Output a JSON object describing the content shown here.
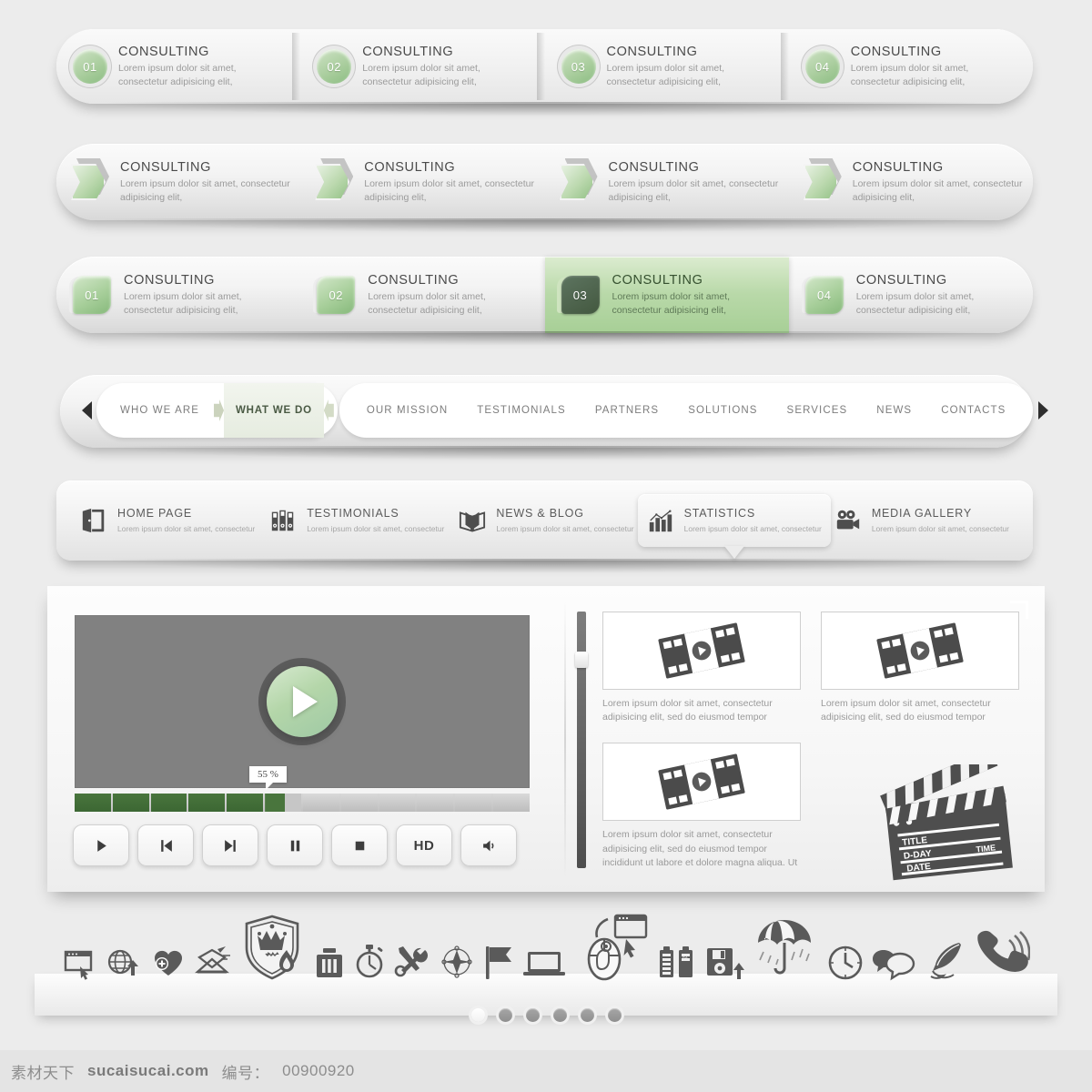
{
  "row1": {
    "items": [
      {
        "num": "01",
        "title": "CONSULTING",
        "desc": "Lorem ipsum dolor sit amet, consectetur adipisicing elit,"
      },
      {
        "num": "02",
        "title": "CONSULTING",
        "desc": "Lorem ipsum dolor sit amet, consectetur adipisicing elit,"
      },
      {
        "num": "03",
        "title": "CONSULTING",
        "desc": "Lorem ipsum dolor sit amet, consectetur adipisicing elit,"
      },
      {
        "num": "04",
        "title": "CONSULTING",
        "desc": "Lorem ipsum dolor sit amet, consectetur adipisicing elit,"
      }
    ]
  },
  "row2": {
    "items": [
      {
        "title": "CONSULTING",
        "desc": "Lorem ipsum dolor sit amet, consectetur adipisicing elit,"
      },
      {
        "title": "CONSULTING",
        "desc": "Lorem ipsum dolor sit amet, consectetur adipisicing elit,"
      },
      {
        "title": "CONSULTING",
        "desc": "Lorem ipsum dolor sit amet, consectetur adipisicing elit,"
      },
      {
        "title": "CONSULTING",
        "desc": "Lorem ipsum dolor sit amet, consectetur adipisicing elit,"
      }
    ]
  },
  "row3": {
    "active_index": 2,
    "items": [
      {
        "num": "01",
        "title": "CONSULTING",
        "desc": "Lorem ipsum dolor sit amet, consectetur adipisicing elit,"
      },
      {
        "num": "02",
        "title": "CONSULTING",
        "desc": "Lorem ipsum dolor sit amet, consectetur adipisicing elit,"
      },
      {
        "num": "03",
        "title": "CONSULTING",
        "desc": "Lorem ipsum dolor sit amet, consectetur adipisicing elit,"
      },
      {
        "num": "04",
        "title": "CONSULTING",
        "desc": "Lorem ipsum dolor sit amet, consectetur adipisicing elit,"
      }
    ]
  },
  "nav": {
    "selected": "WHAT WE DO",
    "primary": [
      "WHO WE ARE",
      "WHAT WE DO"
    ],
    "items": [
      "OUR MISSION",
      "TESTIMONIALS",
      "PARTNERS",
      "SOLUTIONS",
      "SERVICES",
      "NEWS",
      "CONTACTS"
    ]
  },
  "menu": {
    "highlighted": "STATISTICS",
    "items": [
      {
        "icon": "door-icon",
        "title": "HOME PAGE",
        "desc": "Lorem ipsum dolor sit amet, consectetur"
      },
      {
        "icon": "binders-icon",
        "title": "TESTIMONIALS",
        "desc": "Lorem ipsum dolor sit amet, consectetur"
      },
      {
        "icon": "open-book-icon",
        "title": "NEWS & BLOG",
        "desc": "Lorem ipsum dolor sit amet, consectetur"
      },
      {
        "icon": "bar-chart-icon",
        "title": "STATISTICS",
        "desc": "Lorem ipsum dolor sit amet, consectetur"
      },
      {
        "icon": "movie-camera-icon",
        "title": "MEDIA GALLERY",
        "desc": "Lorem ipsum dolor sit amet, consectetur"
      }
    ]
  },
  "player": {
    "progress_label": "55 %",
    "progress_percent": 55,
    "total_segments": 12,
    "controls": [
      {
        "name": "play-button",
        "glyph": "play"
      },
      {
        "name": "previous-button",
        "glyph": "prev"
      },
      {
        "name": "next-button",
        "glyph": "next"
      },
      {
        "name": "pause-button",
        "glyph": "pause"
      },
      {
        "name": "stop-button",
        "glyph": "stop"
      },
      {
        "name": "hd-button",
        "glyph": "HD"
      },
      {
        "name": "volume-button",
        "glyph": "volume"
      }
    ]
  },
  "gallery": {
    "cards": [
      {
        "caption": "Lorem ipsum dolor sit amet, consectetur adipisicing elit, sed do eiusmod tempor"
      },
      {
        "caption": "Lorem ipsum dolor sit amet, consectetur adipisicing elit, sed do eiusmod tempor"
      },
      {
        "caption": "Lorem ipsum dolor sit amet, consectetur adipisicing elit, sed do eiusmod tempor incididunt ut labore et dolore magna aliqua. Ut"
      }
    ],
    "clapperboard": {
      "title": "TITLE",
      "dday": "D-DAY",
      "time": "TIME",
      "date": "DATE"
    }
  },
  "icon_strip": {
    "icons": [
      "browser-window-icon",
      "globe-upload-icon",
      "heart-plus-icon",
      "envelope-send-icon",
      "shield-crown-flame-icon",
      "trash-icon",
      "stopwatch-icon",
      "tools-icon",
      "compass-icon",
      "flag-icon",
      "laptop-icon",
      "mouse-cursor-icon",
      "battery-icon",
      "floppy-upload-icon",
      "umbrella-rain-icon",
      "clock-icon",
      "speech-bubbles-icon",
      "feather-quill-icon",
      "ringing-phone-icon"
    ]
  },
  "pagination": {
    "count": 6,
    "active": 0
  },
  "footer": {
    "brand": "素材天下",
    "site": "sucaisucai.com",
    "code_label": "编号：",
    "code": "00900920"
  },
  "colors": {
    "accent_green": "#9fc98f",
    "active_green": "#a7cf96",
    "progress_green": "#49753d",
    "page_bg": "#ececec"
  }
}
